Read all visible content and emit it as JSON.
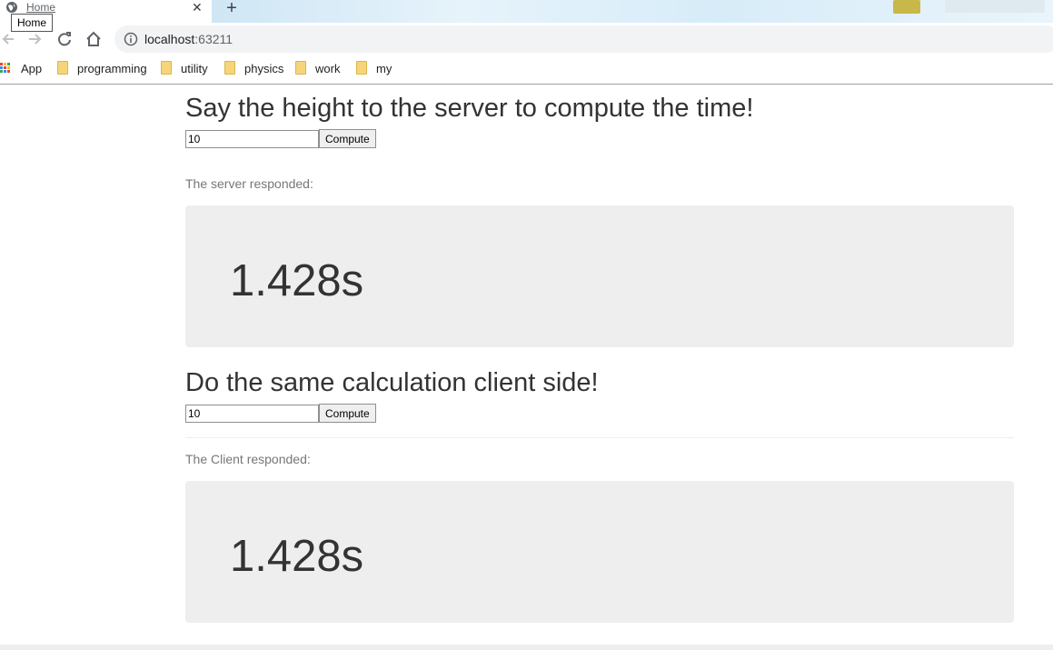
{
  "browser": {
    "tab": {
      "title": "Home",
      "close_icon": "close-icon"
    },
    "tooltip": "Home",
    "new_tab_icon": "plus-icon",
    "address": {
      "host": "localhost",
      "port": ":63211"
    },
    "bookmarks": [
      {
        "label": "App",
        "icon": "apps-grid-icon"
      },
      {
        "label": "programming",
        "icon": "folder-icon"
      },
      {
        "label": "utility",
        "icon": "folder-icon"
      },
      {
        "label": "physics",
        "icon": "folder-icon"
      },
      {
        "label": "work",
        "icon": "folder-icon"
      },
      {
        "label": "my",
        "icon": "folder-icon"
      }
    ]
  },
  "server_section": {
    "heading": "Say the height to the server to compute the time!",
    "input_value": "10",
    "button_label": "Compute",
    "response_label": "The server responded:",
    "result": "1.428s"
  },
  "client_section": {
    "heading": "Do the same calculation client side!",
    "input_value": "10",
    "button_label": "Compute",
    "response_label": "The Client responded:",
    "result": "1.428s"
  }
}
